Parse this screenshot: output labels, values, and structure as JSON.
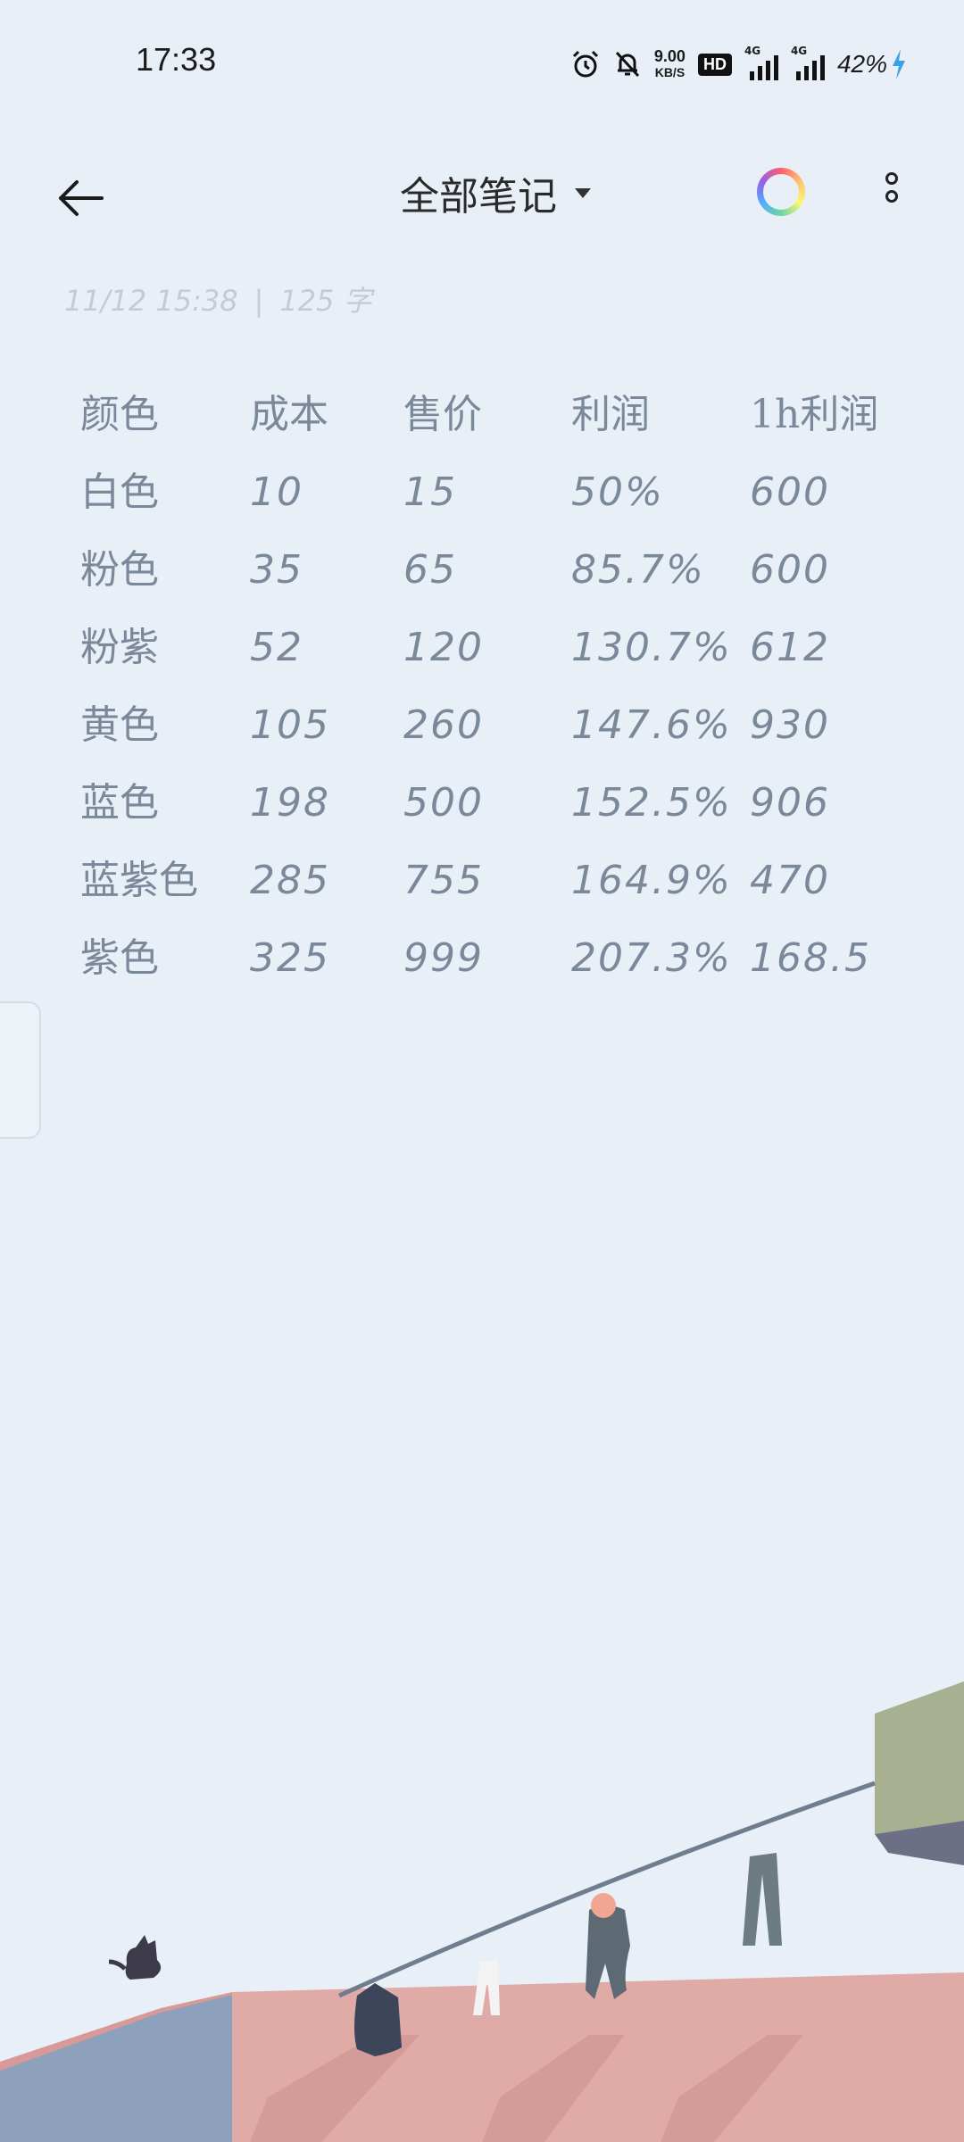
{
  "status_bar": {
    "time": "17:33",
    "net_speed_value": "9.00",
    "net_speed_unit": "KB/S",
    "hd_badge": "HD",
    "signal_1_type": "4G",
    "signal_2_type": "4G",
    "battery": "42%",
    "icons": [
      "alarm-icon",
      "bell-off-icon",
      "signal-icon",
      "signal-icon",
      "charging-icon"
    ]
  },
  "header": {
    "title": "全部笔记",
    "icons": [
      "back-arrow-icon",
      "caret-down-icon",
      "theme-color-ring-icon",
      "more-vertical-icon"
    ]
  },
  "note": {
    "date": "11/12 15:38",
    "separator": "|",
    "word_count": "125 字",
    "headers": [
      "颜色",
      "成本",
      "售价",
      "利润",
      "1h利润"
    ],
    "rows": [
      [
        "白色",
        "10",
        "15",
        "50%",
        "600"
      ],
      [
        "粉色",
        "35",
        "65",
        "85.7%",
        "600"
      ],
      [
        "粉紫",
        "52",
        "120",
        "130.7%",
        "612"
      ],
      [
        "黄色",
        "105",
        "260",
        "147.6%",
        "930"
      ],
      [
        "蓝色",
        "198",
        "500",
        "152.5%",
        "906"
      ],
      [
        "蓝紫色",
        "285",
        "755",
        "164.9%",
        "470"
      ],
      [
        "紫色",
        "325",
        "999",
        "207.3%",
        "168.5"
      ]
    ]
  },
  "colors": {
    "background": "#e8eff7",
    "note_text": "#7b889a",
    "meta_text": "#c4cbd4"
  }
}
